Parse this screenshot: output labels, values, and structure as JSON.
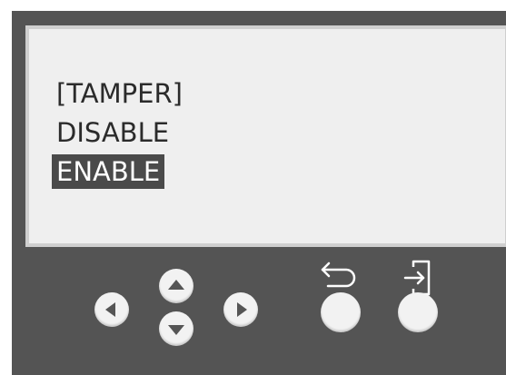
{
  "display": {
    "title": "[TAMPER]",
    "options": [
      "DISABLE",
      "ENABLE"
    ],
    "selected_option": "ENABLE"
  },
  "keypad": {
    "buttons": [
      {
        "name": "nav-left-button",
        "icon": "triangle-left-icon"
      },
      {
        "name": "nav-up-button",
        "icon": "triangle-up-icon"
      },
      {
        "name": "nav-down-button",
        "icon": "triangle-down-icon"
      },
      {
        "name": "nav-right-button",
        "icon": "triangle-right-icon"
      },
      {
        "name": "back-button",
        "icon": "return-arrow-icon"
      },
      {
        "name": "enter-button",
        "icon": "enter-arrow-icon"
      }
    ]
  },
  "colors": {
    "device_body": "#545454",
    "screen_bg": "#efefef",
    "screen_border": "#cfcfcf",
    "highlight_bg": "#4a4a4a",
    "text": "#2b2b2b",
    "button_face": "#f2f2f2",
    "arrow": "#555555"
  }
}
